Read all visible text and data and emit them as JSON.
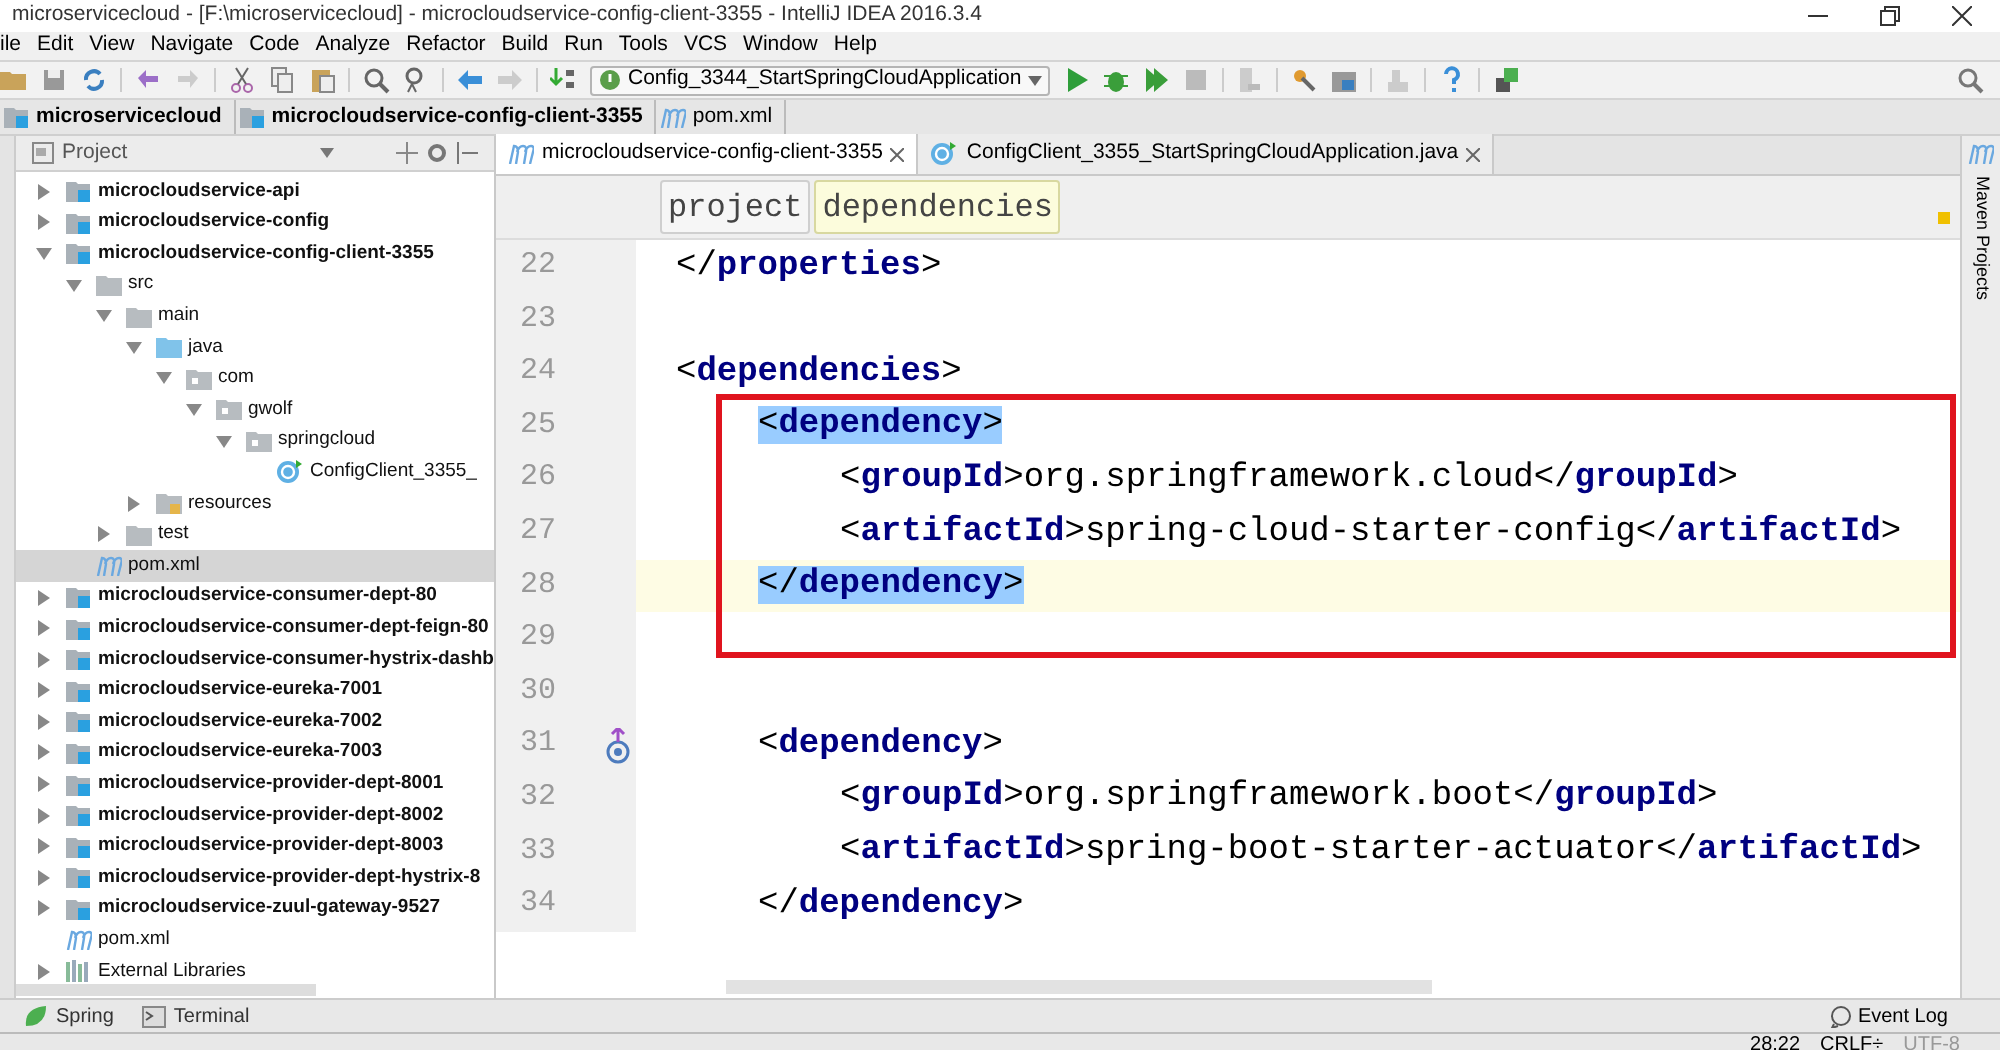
{
  "window": {
    "title": "microservicecloud - [F:\\microservicecloud] - microcloudservice-config-client-3355 - IntelliJ IDEA 2016.3.4"
  },
  "menu": [
    "ile",
    "Edit",
    "View",
    "Navigate",
    "Code",
    "Analyze",
    "Refactor",
    "Build",
    "Run",
    "Tools",
    "VCS",
    "Window",
    "Help"
  ],
  "toolbar": {
    "run_config": "Config_3344_StartSpringCloudApplication"
  },
  "navigation_bar": [
    {
      "kind": "module",
      "label": "microservicecloud"
    },
    {
      "kind": "module",
      "label": "microcloudservice-config-client-3355"
    },
    {
      "kind": "maven",
      "label": "pom.xml"
    }
  ],
  "project_panel": {
    "title": "Project",
    "tree": [
      {
        "kind": "module",
        "label": "microcloudservice-api",
        "expanded": false,
        "selected": false
      },
      {
        "kind": "module",
        "label": "microcloudservice-config",
        "expanded": false,
        "selected": false
      },
      {
        "kind": "module",
        "label": "microcloudservice-config-client-3355",
        "expanded": true,
        "selected": false,
        "children": [
          {
            "kind": "folder",
            "label": "src",
            "expanded": true,
            "selected": false,
            "children": [
              {
                "kind": "folder",
                "label": "main",
                "expanded": true,
                "selected": false,
                "children": [
                  {
                    "kind": "source",
                    "label": "java",
                    "expanded": true,
                    "selected": false,
                    "children": [
                      {
                        "kind": "package",
                        "label": "com",
                        "expanded": true,
                        "selected": false,
                        "children": [
                          {
                            "kind": "package",
                            "label": "gwolf",
                            "expanded": true,
                            "selected": false,
                            "children": [
                              {
                                "kind": "package",
                                "label": "springcloud",
                                "expanded": true,
                                "selected": false,
                                "children": [
                                  {
                                    "kind": "class",
                                    "label": "ConfigClient_3355_",
                                    "selected": false
                                  }
                                ]
                              }
                            ]
                          }
                        ]
                      }
                    ]
                  },
                  {
                    "kind": "resources",
                    "label": "resources",
                    "expanded": false,
                    "selected": false
                  }
                ]
              },
              {
                "kind": "folder",
                "label": "test",
                "expanded": false,
                "selected": false
              }
            ]
          },
          {
            "kind": "maven",
            "label": "pom.xml",
            "selected": true
          }
        ]
      },
      {
        "kind": "module",
        "label": "microcloudservice-consumer-dept-80",
        "expanded": false,
        "selected": false
      },
      {
        "kind": "module",
        "label": "microcloudservice-consumer-dept-feign-80",
        "expanded": false,
        "selected": false
      },
      {
        "kind": "module",
        "label": "microcloudservice-consumer-hystrix-dashb",
        "expanded": false,
        "selected": false
      },
      {
        "kind": "module",
        "label": "microcloudservice-eureka-7001",
        "expanded": false,
        "selected": false
      },
      {
        "kind": "module",
        "label": "microcloudservice-eureka-7002",
        "expanded": false,
        "selected": false
      },
      {
        "kind": "module",
        "label": "microcloudservice-eureka-7003",
        "expanded": false,
        "selected": false
      },
      {
        "kind": "module",
        "label": "microcloudservice-provider-dept-8001",
        "expanded": false,
        "selected": false
      },
      {
        "kind": "module",
        "label": "microcloudservice-provider-dept-8002",
        "expanded": false,
        "selected": false
      },
      {
        "kind": "module",
        "label": "microcloudservice-provider-dept-8003",
        "expanded": false,
        "selected": false
      },
      {
        "kind": "module",
        "label": "microcloudservice-provider-dept-hystrix-8",
        "expanded": false,
        "selected": false
      },
      {
        "kind": "module",
        "label": "microcloudservice-zuul-gateway-9527",
        "expanded": false,
        "selected": false
      },
      {
        "kind": "maven",
        "label": "pom.xml",
        "selected": false
      },
      {
        "kind": "library",
        "label": "External Libraries",
        "expanded": false,
        "selected": false
      }
    ]
  },
  "editor": {
    "tabs": [
      {
        "kind": "maven",
        "label": "microcloudservice-config-client-3355",
        "selected": true
      },
      {
        "kind": "class",
        "label": "ConfigClient_3355_StartSpringCloudApplication.java",
        "selected": false
      }
    ],
    "breadcrumbs": [
      {
        "label": "project",
        "selected": false
      },
      {
        "label": "dependencies",
        "selected": true
      }
    ],
    "lines": [
      {
        "number": "22",
        "current": false,
        "segments": [
          {
            "kind": "punct",
            "text": "</"
          },
          {
            "kind": "tag",
            "text": "properties"
          },
          {
            "kind": "punct",
            "text": ">"
          }
        ]
      },
      {
        "number": "23",
        "current": false
      },
      {
        "number": "24",
        "current": false,
        "segments": [
          {
            "kind": "punct",
            "text": "<"
          },
          {
            "kind": "tag",
            "text": "dependencies"
          },
          {
            "kind": "punct",
            "text": ">"
          }
        ]
      },
      {
        "number": "25",
        "current": false,
        "kind": "child",
        "segments": [
          {
            "kind": "punct",
            "text": "<",
            "highlighted": true
          },
          {
            "kind": "tag",
            "text": "dependency",
            "highlighted": true
          },
          {
            "kind": "punct",
            "text": ">",
            "highlighted": true
          }
        ]
      },
      {
        "number": "26",
        "current": false,
        "kind": "grandchild",
        "segments": [
          {
            "kind": "punct",
            "text": "<"
          },
          {
            "kind": "tag",
            "text": "groupId"
          },
          {
            "kind": "punct",
            "text": ">"
          },
          {
            "kind": "text",
            "text": "org.springframework.cloud"
          },
          {
            "kind": "punct",
            "text": "</"
          },
          {
            "kind": "tag",
            "text": "groupId"
          },
          {
            "kind": "punct",
            "text": ">"
          }
        ]
      },
      {
        "number": "27",
        "current": false,
        "kind": "grandchild",
        "segments": [
          {
            "kind": "punct",
            "text": "<"
          },
          {
            "kind": "tag",
            "text": "artifactId"
          },
          {
            "kind": "punct",
            "text": ">"
          },
          {
            "kind": "text",
            "text": "spring-cloud-starter-config"
          },
          {
            "kind": "punct",
            "text": "</"
          },
          {
            "kind": "tag",
            "text": "artifactId"
          },
          {
            "kind": "punct",
            "text": ">"
          }
        ]
      },
      {
        "number": "28",
        "current": true,
        "kind": "child",
        "segments": [
          {
            "kind": "punct",
            "text": "</",
            "highlighted": true
          },
          {
            "kind": "tag",
            "text": "dependency",
            "highlighted": true
          },
          {
            "kind": "punct",
            "text": ">",
            "highlighted": true
          }
        ]
      },
      {
        "number": "29",
        "current": false
      },
      {
        "number": "30",
        "current": false
      },
      {
        "number": "31",
        "current": false,
        "gutter_icon": true,
        "kind": "child",
        "segments": [
          {
            "kind": "punct",
            "text": "<"
          },
          {
            "kind": "tag",
            "text": "dependency"
          },
          {
            "kind": "punct",
            "text": ">"
          }
        ]
      },
      {
        "number": "32",
        "current": false,
        "kind": "grandchild",
        "segments": [
          {
            "kind": "punct",
            "text": "<"
          },
          {
            "kind": "tag",
            "text": "groupId"
          },
          {
            "kind": "punct",
            "text": ">"
          },
          {
            "kind": "text",
            "text": "org.springframework.boot"
          },
          {
            "kind": "punct",
            "text": "</"
          },
          {
            "kind": "tag",
            "text": "groupId"
          },
          {
            "kind": "punct",
            "text": ">"
          }
        ]
      },
      {
        "number": "33",
        "current": false,
        "kind": "grandchild",
        "segments": [
          {
            "kind": "punct",
            "text": "<"
          },
          {
            "kind": "tag",
            "text": "artifactId"
          },
          {
            "kind": "punct",
            "text": ">"
          },
          {
            "kind": "text",
            "text": "spring-boot-starter-actuator"
          },
          {
            "kind": "punct",
            "text": "</"
          },
          {
            "kind": "tag",
            "text": "artifactId"
          },
          {
            "kind": "punct",
            "text": ">"
          }
        ]
      },
      {
        "number": "34",
        "current": false,
        "kind": "child",
        "segments": [
          {
            "kind": "punct",
            "text": "</"
          },
          {
            "kind": "tag",
            "text": "dependency"
          },
          {
            "kind": "punct",
            "text": ">"
          }
        ]
      }
    ]
  },
  "right_stripe": {
    "label": "Maven Projects"
  },
  "tool_buttons": [
    {
      "kind": "spring",
      "label": "Spring"
    },
    {
      "kind": "terminal",
      "label": "Terminal"
    }
  ],
  "event_log": "Event Log",
  "status_bar": [
    {
      "label": "28:22",
      "disabled": false
    },
    {
      "label": "CRLF÷",
      "disabled": false
    },
    {
      "label": "UTF-8",
      "disabled": true
    }
  ]
}
